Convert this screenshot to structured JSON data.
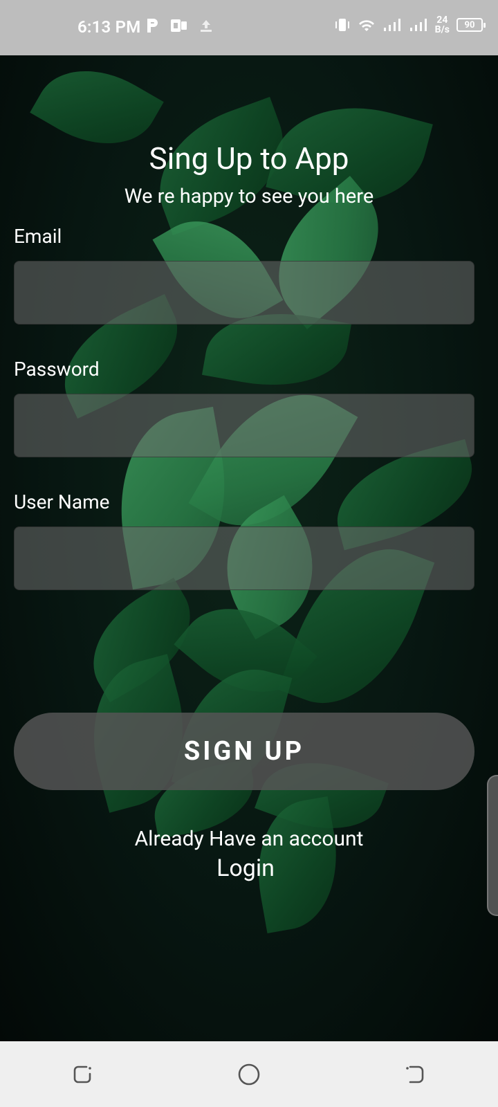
{
  "status_bar": {
    "time": "6:13 PM",
    "speed_top": "24",
    "speed_bottom": "B/s",
    "battery": "90",
    "icons": [
      "p-icon",
      "app-notification-icon",
      "upload-icon",
      "vibrate-icon",
      "wifi-icon",
      "signal-icon",
      "signal-icon"
    ]
  },
  "form": {
    "title": "Sing Up to App",
    "subtitle": "We re happy to see you here",
    "email_label": "Email",
    "email_value": "",
    "password_label": "Password",
    "password_value": "",
    "username_label": "User Name",
    "username_value": "",
    "signup_button": "SIGN UP",
    "already_text": "Already Have an account",
    "login_link": "Login"
  },
  "nav_bar": {
    "buttons": [
      "recent-apps-icon",
      "home-icon",
      "back-icon"
    ]
  }
}
